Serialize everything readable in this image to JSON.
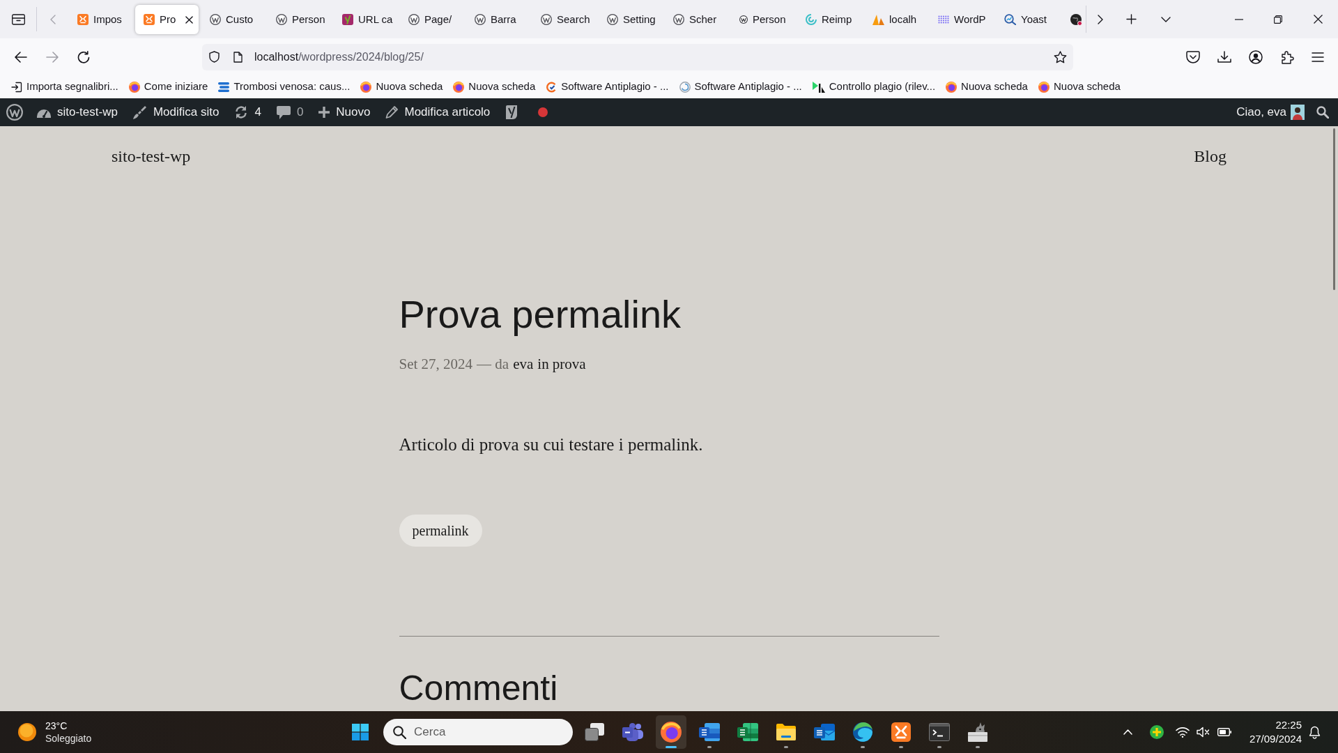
{
  "browser": {
    "tabs": [
      {
        "label": "Impos",
        "kind": "xampp",
        "selected": false
      },
      {
        "label": "Pro",
        "kind": "xampp",
        "selected": true
      },
      {
        "label": "Custo",
        "kind": "wordpress",
        "selected": false
      },
      {
        "label": "Person",
        "kind": "wordpress",
        "selected": false
      },
      {
        "label": "URL ca",
        "kind": "yoast",
        "selected": false
      },
      {
        "label": "Page/",
        "kind": "wordpress",
        "selected": false
      },
      {
        "label": "Barra",
        "kind": "wordpress",
        "selected": false
      },
      {
        "label": "Search",
        "kind": "wordpress",
        "selected": false
      },
      {
        "label": "Setting",
        "kind": "wordpress",
        "selected": false
      },
      {
        "label": "Scher",
        "kind": "wordpress",
        "selected": false
      },
      {
        "label": "Person",
        "kind": "wpsmall",
        "selected": false
      },
      {
        "label": "Reimp",
        "kind": "swirl",
        "selected": false
      },
      {
        "label": "localh",
        "kind": "pma",
        "selected": false
      },
      {
        "label": "WordP",
        "kind": "dots",
        "selected": false
      },
      {
        "label": "Yoast",
        "kind": "chart",
        "selected": false
      },
      {
        "kind": "globe",
        "selected": false
      }
    ],
    "address": {
      "host": "localhost",
      "path": "/wordpress/2024/blog/25/"
    },
    "bookmarks": [
      {
        "label": "Importa segnalibri...",
        "kind": "import"
      },
      {
        "label": "Come iniziare",
        "kind": "firefox"
      },
      {
        "label": "Trombosi venosa: caus...",
        "kind": "stripes"
      },
      {
        "label": "Nuova scheda",
        "kind": "firefox"
      },
      {
        "label": "Nuova scheda",
        "kind": "firefox"
      },
      {
        "label": "Software Antiplagio - ...",
        "kind": "antiplag"
      },
      {
        "label": "Software Antiplagio - ...",
        "kind": "spiral"
      },
      {
        "label": "Controllo plagio (rilev...",
        "kind": "pr"
      },
      {
        "label": "Nuova scheda",
        "kind": "firefox"
      },
      {
        "label": "Nuova scheda",
        "kind": "firefox"
      }
    ]
  },
  "admin_bar": {
    "items": [
      {
        "kind": "dashboard",
        "label": "sito-test-wp"
      },
      {
        "kind": "customize",
        "label": "Modifica sito"
      },
      {
        "kind": "updates",
        "label": "4"
      },
      {
        "kind": "comments",
        "label": "0"
      },
      {
        "kind": "new",
        "label": "Nuovo"
      },
      {
        "kind": "edit",
        "label": "Modifica articolo"
      },
      {
        "kind": "seo"
      }
    ],
    "greeting": "Ciao, eva"
  },
  "site": {
    "title": "sito-test-wp",
    "nav": [
      {
        "label": "Blog"
      }
    ]
  },
  "post": {
    "title": "Prova permalink",
    "date": "Set 27, 2024",
    "byline": "— da",
    "author": "eva",
    "category_prefix": "in",
    "category": "prova",
    "body": "Articolo di prova su cui testare i permalink.",
    "tags": [
      "permalink"
    ],
    "comments_title": "Commenti"
  },
  "taskbar": {
    "weather": {
      "temperature": "23°C",
      "condition": "Soleggiato"
    },
    "search": {
      "placeholder": "Cerca"
    },
    "apps": [
      {
        "kind": "taskview",
        "running": false,
        "selected": false
      },
      {
        "kind": "teams",
        "running": false,
        "selected": false
      },
      {
        "kind": "firefox",
        "running": true,
        "selected": true
      },
      {
        "kind": "word",
        "running": true,
        "selected": false
      },
      {
        "kind": "excel",
        "running": false,
        "selected": false
      },
      {
        "kind": "explorer",
        "running": true,
        "selected": false
      },
      {
        "kind": "outlook",
        "running": false,
        "selected": false
      },
      {
        "kind": "edge",
        "running": true,
        "selected": false
      },
      {
        "kind": "xampp",
        "running": true,
        "selected": false
      },
      {
        "kind": "terminal",
        "running": true,
        "selected": false
      },
      {
        "kind": "mascot",
        "running": true,
        "selected": false
      }
    ],
    "clock": {
      "time": "22:25",
      "date": "27/09/2024"
    }
  }
}
